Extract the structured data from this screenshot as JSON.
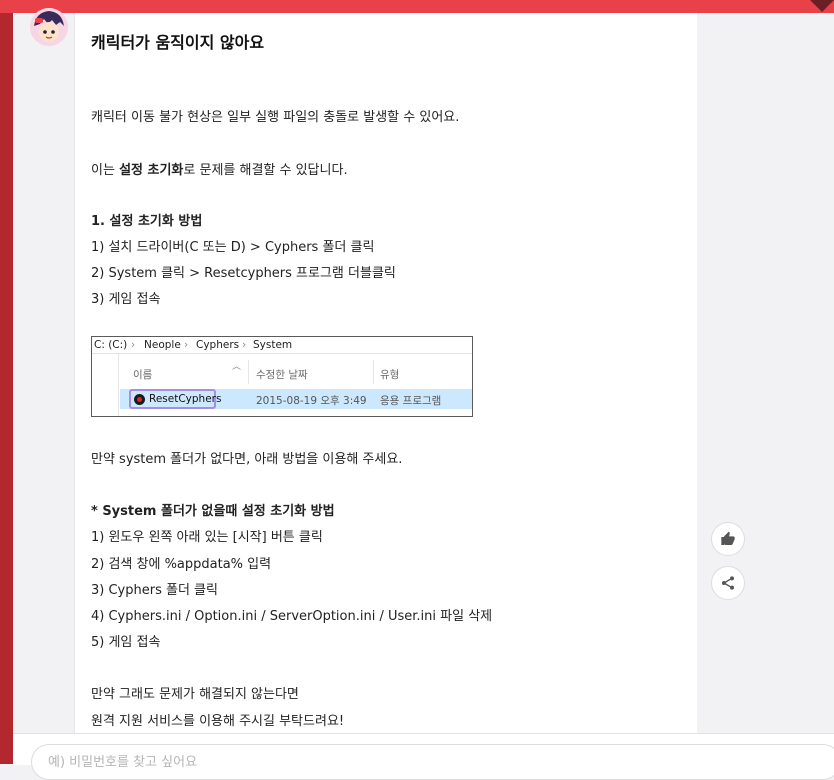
{
  "article": {
    "title": "캐릭터가 움직이지 않아요",
    "p1": "캐릭터 이동 불가 현상은 일부 실행 파일의 충돌로 발생할 수 있어요.",
    "p2_pre": "이는 ",
    "p2_bold": "설정 초기화",
    "p2_post": "로 문제를 해결할 수 있답니다.",
    "section1": "1. 설정 초기화 방법",
    "steps1": [
      "1) 설치 드라이버(C 또는 D) > Cyphers 폴더 클릭",
      "2) System 클릭 > Resetcyphers 프로그램 더블클릭",
      "3) 게임 접속"
    ],
    "p3": "만약 system 폴더가 없다면, 아래 방법을 이용해 주세요.",
    "section2": "* System 폴더가 없을때 설정 초기화 방법",
    "steps2": [
      "1) 윈도우 왼쪽 아래 있는 [시작] 버튼 클릭",
      "2) 검색 창에 %appdata% 입력",
      "3) Cyphers 폴더 클릭",
      "4) Cyphers.ini / Option.ini / ServerOption.ini / User.ini 파일 삭제",
      "5) 게임 접속"
    ],
    "p4a": "만약 그래도 문제가 해결되지 않는다면",
    "p4b": "원격 지원 서비스를 이용해 주시길 부탁드려요!"
  },
  "explorer": {
    "path": [
      "C: (C:)",
      "›",
      "Neople",
      "›",
      "Cyphers",
      "›",
      "System"
    ],
    "col_name": "이름",
    "col_date": "수정한 날짜",
    "col_type": "유형",
    "file_name": "ResetCyphers",
    "file_date": "2015-08-19 오후 3:49",
    "file_type": "응용 프로그램"
  },
  "actions": {
    "like_icon": "thumbs-up-icon",
    "share_icon": "share-icon"
  },
  "composer": {
    "placeholder": "예) 비밀번호를 찾고 싶어요"
  },
  "colors": {
    "accent": "#e8414a",
    "sidebar": "#b3282e",
    "highlight_border": "#a58ee8",
    "selected_row": "#cce8ff"
  }
}
